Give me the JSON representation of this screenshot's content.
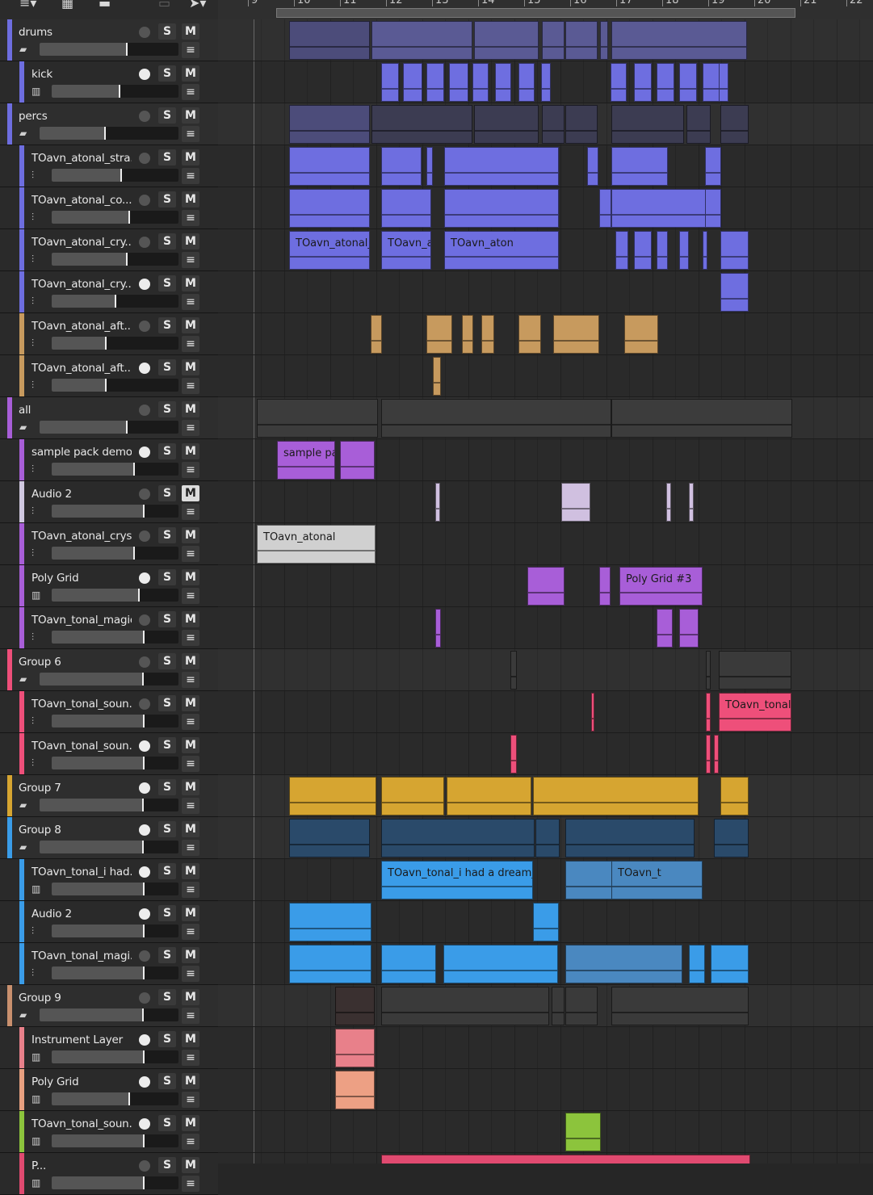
{
  "toolbar": {
    "icons": [
      "list-dropdown-icon",
      "grid-view-icon",
      "list-view-icon",
      "zoom-icon",
      "pointer-tool-icon"
    ]
  },
  "ruler": {
    "bars": [
      "9",
      "10",
      "11",
      "12",
      "13",
      "14",
      "15",
      "16",
      "17",
      "18",
      "19",
      "20",
      "21",
      "22"
    ]
  },
  "buttons": {
    "solo": "S",
    "mute": "M",
    "menu": "≡"
  },
  "tracks": [
    {
      "name": "drums",
      "type": "group",
      "color": "#6e6ee0",
      "rec": false,
      "level": 0.8,
      "icon": "folder-icon"
    },
    {
      "name": "kick",
      "type": "child",
      "color": "#6e6ee0",
      "rec": true,
      "level": 0.7,
      "icon": "drum-kit-icon"
    },
    {
      "name": "percs",
      "type": "group",
      "color": "#6e6ee0",
      "rec": false,
      "level": 0.6,
      "icon": "folder-icon"
    },
    {
      "name": "TOavn_atonal_stra...",
      "type": "child",
      "color": "#6e6ee0",
      "rec": false,
      "level": 0.72,
      "icon": "audio-waveform-icon"
    },
    {
      "name": "TOavn_atonal_co...",
      "type": "child",
      "color": "#6e6ee0",
      "rec": false,
      "level": 0.8,
      "icon": "audio-waveform-icon"
    },
    {
      "name": "TOavn_atonal_cry...",
      "type": "child",
      "color": "#6e6ee0",
      "rec": false,
      "level": 0.78,
      "icon": "audio-waveform-icon"
    },
    {
      "name": "TOavn_atonal_cry...",
      "type": "child",
      "color": "#6e6ee0",
      "rec": true,
      "level": 0.66,
      "icon": "audio-waveform-icon"
    },
    {
      "name": "TOavn_atonal_aft...",
      "type": "child",
      "color": "#c79a5e",
      "rec": false,
      "level": 0.56,
      "icon": "audio-waveform-icon"
    },
    {
      "name": "TOavn_atonal_aft...",
      "type": "child",
      "color": "#c79a5e",
      "rec": true,
      "level": 0.56,
      "icon": "audio-waveform-icon"
    },
    {
      "name": "all",
      "type": "group",
      "color": "#a85ed8",
      "rec": false,
      "level": 0.8,
      "icon": "folder-icon"
    },
    {
      "name": "sample pack demo s...",
      "type": "child",
      "color": "#a85ed8",
      "rec": true,
      "level": 0.85,
      "icon": "audio-waveform-icon"
    },
    {
      "name": "Audio 2",
      "type": "child",
      "color": "#d0c8e0",
      "rec": false,
      "level": 0.95,
      "icon": "audio-waveform-icon",
      "muted": true
    },
    {
      "name": "TOavn_atonal_cryst...",
      "type": "child",
      "color": "#a85ed8",
      "rec": false,
      "level": 0.85,
      "icon": "audio-waveform-icon"
    },
    {
      "name": "Poly Grid",
      "type": "child",
      "color": "#a85ed8",
      "rec": true,
      "level": 0.9,
      "icon": "piano-keys-icon"
    },
    {
      "name": "TOavn_tonal_magic...",
      "type": "child",
      "color": "#a85ed8",
      "rec": false,
      "level": 0.95,
      "icon": "audio-waveform-icon"
    },
    {
      "name": "Group 6",
      "type": "group",
      "color": "#ee4f7a",
      "rec": false,
      "level": 0.95,
      "icon": "folder-icon"
    },
    {
      "name": "TOavn_tonal_soun...",
      "type": "child",
      "color": "#ee4f7a",
      "rec": false,
      "level": 0.95,
      "icon": "audio-waveform-icon"
    },
    {
      "name": "TOavn_tonal_soun...",
      "type": "child",
      "color": "#ee4f7a",
      "rec": true,
      "level": 0.95,
      "icon": "audio-waveform-icon"
    },
    {
      "name": "Group 7",
      "type": "group",
      "color": "#d6a531",
      "rec": true,
      "level": 0.95,
      "icon": "folder-icon"
    },
    {
      "name": "Group 8",
      "type": "group",
      "color": "#3a9ce8",
      "rec": true,
      "level": 0.95,
      "icon": "folder-icon"
    },
    {
      "name": "TOavn_tonal_i had...",
      "type": "child",
      "color": "#3a9ce8",
      "rec": true,
      "level": 0.95,
      "icon": "piano-keys-icon"
    },
    {
      "name": "Audio 2",
      "type": "child",
      "color": "#3a9ce8",
      "rec": true,
      "level": 0.95,
      "icon": "audio-waveform-icon"
    },
    {
      "name": "TOavn_tonal_magi...",
      "type": "child",
      "color": "#3a9ce8",
      "rec": false,
      "level": 0.95,
      "icon": "audio-waveform-icon"
    },
    {
      "name": "Group 9",
      "type": "group",
      "color": "#c9906e",
      "rec": false,
      "level": 0.95,
      "icon": "folder-icon"
    },
    {
      "name": "Instrument Layer",
      "type": "child",
      "color": "#e8808a",
      "rec": true,
      "level": 0.95,
      "icon": "piano-keys-icon"
    },
    {
      "name": "Poly Grid",
      "type": "child",
      "color": "#e8a080",
      "rec": true,
      "level": 0.8,
      "icon": "piano-keys-icon"
    },
    {
      "name": "TOavn_tonal_soun...",
      "type": "child",
      "color": "#8cc43c",
      "rec": true,
      "level": 0.95,
      "icon": "piano-keys-icon"
    },
    {
      "name": "P...",
      "type": "child",
      "color": "#e04a70",
      "rec": false,
      "level": 0.95,
      "icon": "piano-keys-icon"
    }
  ],
  "clip_labels": {
    "atonal_a": "TOavn_atonal_",
    "atonal_b": "TOavn_a",
    "atonal_c": "TOavn_aton",
    "sample": "sample pa",
    "atonal_grey": "TOavn_atonal",
    "polygrid3": "Poly Grid #3",
    "tonal_pink": "TOavn_tonal",
    "dream": "TOavn_tonal_i had a dream_r",
    "tonal_t": "TOavn_t"
  },
  "colors": {
    "drums": "#6e6ee0",
    "aft": "#c79a5e",
    "all": "#a85ed8",
    "pink": "#ee4f7a",
    "gold": "#d6a531",
    "blue": "#3a9ce8",
    "salmon": "#e8808a",
    "green": "#8cc43c"
  }
}
